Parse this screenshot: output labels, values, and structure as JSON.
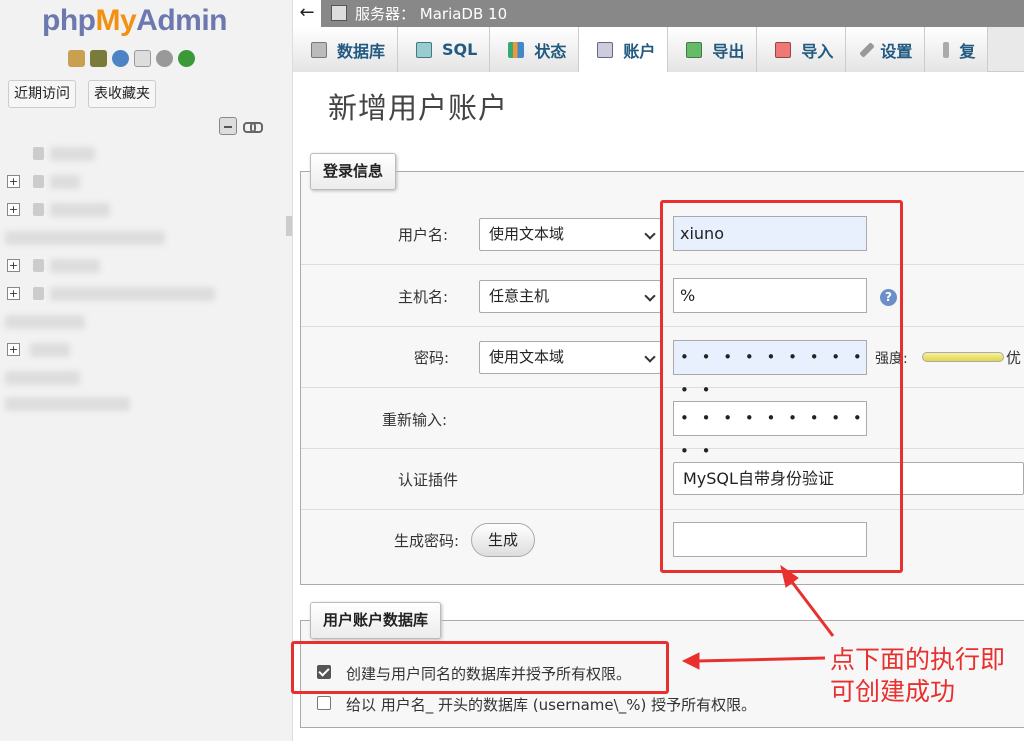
{
  "sidebar": {
    "logo_php": "php",
    "logo_my": "My",
    "logo_admin": "Admin",
    "quick_icons": [
      "home-icon",
      "database-icon",
      "help-icon",
      "docs-icon",
      "settings-icon",
      "reload-icon"
    ],
    "recent_button": "近期访问",
    "favorites_button": "表收藏夹"
  },
  "topbar": {
    "back_arrow": "←",
    "server_label": "服务器：  MariaDB 10"
  },
  "tabs": [
    {
      "label": "数据库",
      "icon": "database-icon"
    },
    {
      "label": "SQL",
      "icon": "sql-icon"
    },
    {
      "label": "状态",
      "icon": "status-icon"
    },
    {
      "label": "账户",
      "icon": "accounts-icon",
      "active": true
    },
    {
      "label": "导出",
      "icon": "export-icon"
    },
    {
      "label": "导入",
      "icon": "import-icon"
    },
    {
      "label": "设置",
      "icon": "settings-icon"
    },
    {
      "label": "复",
      "icon": "replication-icon"
    }
  ],
  "page": {
    "title": "新增用户账户"
  },
  "login_info": {
    "legend": "登录信息",
    "username_label": "用户名:",
    "username_type": "使用文本域",
    "username_value": "xiuno",
    "host_label": "主机名:",
    "host_type": "任意主机",
    "host_value": "%",
    "password_label": "密码:",
    "password_type": "使用文本域",
    "password_value": "• • • • • • • • • • •",
    "strength_label": "强度:",
    "strength_value": "优",
    "retype_label": "重新输入:",
    "retype_value": "• • • • • • • • • • •",
    "auth_plugin_label": "认证插件",
    "auth_plugin_value": "MySQL自带身份验证",
    "generate_label": "生成密码:",
    "generate_button": "生成",
    "generated_value": ""
  },
  "user_db": {
    "legend": "用户账户数据库",
    "option1": "创建与用户同名的数据库并授予所有权限。",
    "option1_checked": true,
    "option2": "给以 用户名_ 开头的数据库 (username\\_%) 授予所有权限。",
    "option2_checked": false
  },
  "annotation": {
    "note": "点下面的执行即可创建成功",
    "color": "#e8312f"
  }
}
